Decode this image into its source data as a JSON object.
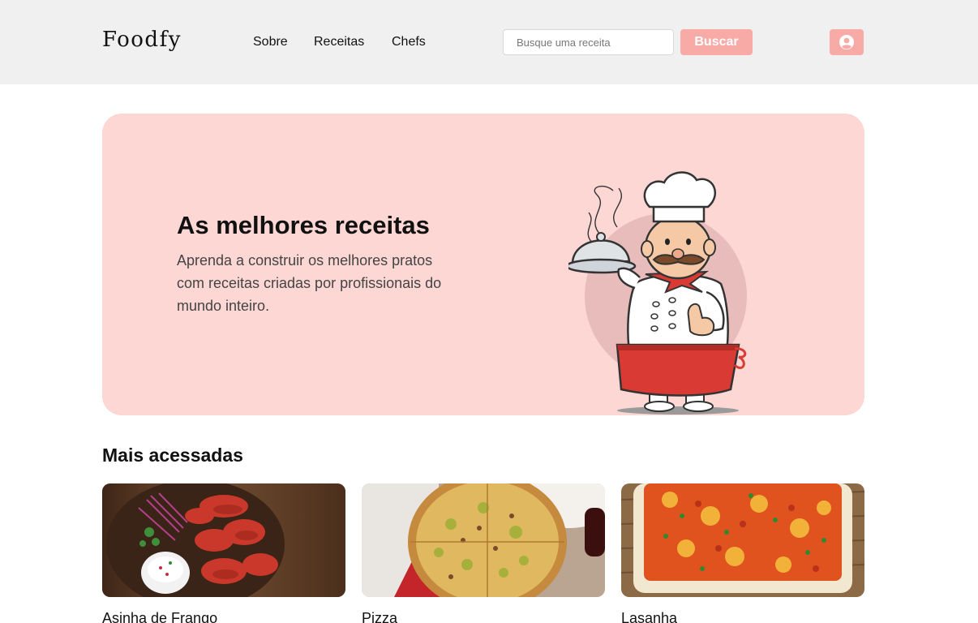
{
  "header": {
    "logo": "Foodfy",
    "nav": [
      {
        "label": "Sobre"
      },
      {
        "label": "Receitas"
      },
      {
        "label": "Chefs"
      }
    ],
    "search": {
      "placeholder": "Busque uma receita",
      "value": ""
    },
    "search_button": "Buscar",
    "user_icon": "user-circle-icon"
  },
  "hero": {
    "title": "As melhores receitas",
    "text": "Aprenda a construir os melhores pratos com receitas criadas por profissionais do mundo inteiro.",
    "illustration": "chef-illustration"
  },
  "section": {
    "title": "Mais acessadas",
    "recipes": [
      {
        "name": "Asinha de Frango"
      },
      {
        "name": "Pizza"
      },
      {
        "name": "Lasanha"
      }
    ]
  },
  "colors": {
    "accent": "#f8aaa6",
    "hero_bg": "#fdd7d4",
    "header_bg": "#f0f0f1"
  }
}
